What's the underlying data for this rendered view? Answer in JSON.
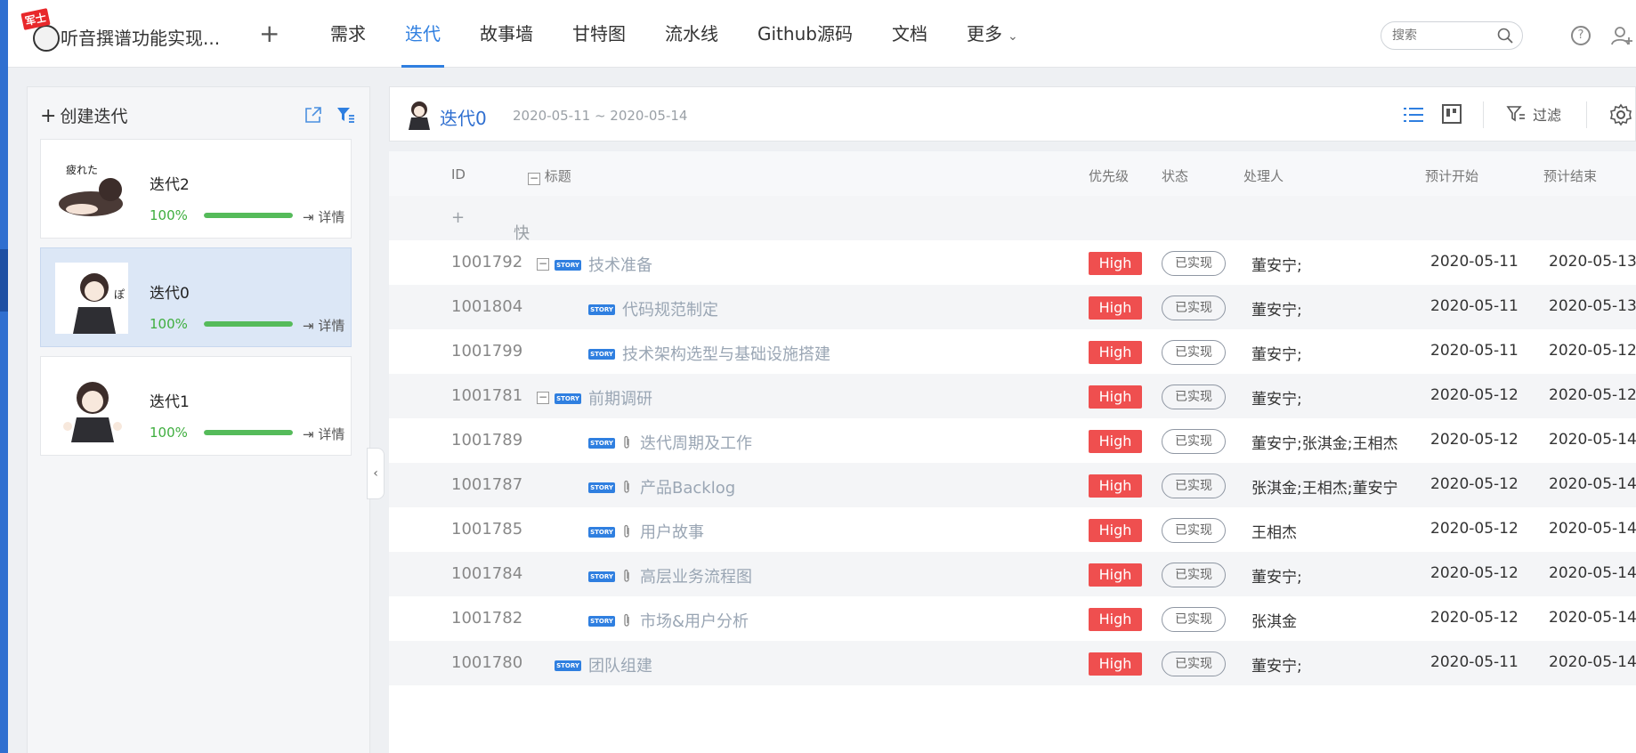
{
  "project": {
    "name": "听音撰谱功能实现...",
    "badge": "军士"
  },
  "nav": {
    "tabs": [
      {
        "label": "需求"
      },
      {
        "label": "迭代"
      },
      {
        "label": "故事墙"
      },
      {
        "label": "甘特图"
      },
      {
        "label": "流水线"
      },
      {
        "label": "Github源码"
      },
      {
        "label": "文档"
      },
      {
        "label": "更多"
      }
    ],
    "active_index": 1,
    "search_placeholder": "搜索"
  },
  "sidebar": {
    "create_label": "创建迭代",
    "iterations": [
      {
        "name": "迭代2",
        "percent": "100%",
        "progress": 1.0,
        "detail_label": "详情",
        "thumb_text": "疲れた"
      },
      {
        "name": "迭代0",
        "percent": "100%",
        "progress": 1.0,
        "detail_label": "详情",
        "thumb_text": "ぽ"
      },
      {
        "name": "迭代1",
        "percent": "100%",
        "progress": 1.0,
        "detail_label": "详情",
        "thumb_text": ""
      }
    ]
  },
  "iteration_header": {
    "title": "迭代0",
    "date_range": "2020-05-11 ~ 2020-05-14",
    "filter_label": "过滤"
  },
  "table": {
    "columns": {
      "id": "ID",
      "title": "标题",
      "priority": "优先级",
      "status": "状态",
      "owner": "处理人",
      "start": "预计开始",
      "end": "预计结束"
    },
    "quick_create_label": "快速创建",
    "story_tag": "STORY",
    "rows": [
      {
        "id": "1001792",
        "title": "技术准备",
        "level": 0,
        "foldable": true,
        "attachment": false,
        "priority": "High",
        "status": "已实现",
        "owner": "董安宁;",
        "start": "2020-05-11",
        "end": "2020-05-13"
      },
      {
        "id": "1001804",
        "title": "代码规范制定",
        "level": 1,
        "foldable": false,
        "attachment": false,
        "priority": "High",
        "status": "已实现",
        "owner": "董安宁;",
        "start": "2020-05-11",
        "end": "2020-05-13"
      },
      {
        "id": "1001799",
        "title": "技术架构选型与基础设施搭建",
        "level": 1,
        "foldable": false,
        "attachment": false,
        "priority": "High",
        "status": "已实现",
        "owner": "董安宁;",
        "start": "2020-05-11",
        "end": "2020-05-12"
      },
      {
        "id": "1001781",
        "title": "前期调研",
        "level": 0,
        "foldable": true,
        "attachment": false,
        "priority": "High",
        "status": "已实现",
        "owner": "董安宁;",
        "start": "2020-05-12",
        "end": "2020-05-12"
      },
      {
        "id": "1001789",
        "title": "迭代周期及工作",
        "level": 1,
        "foldable": false,
        "attachment": true,
        "priority": "High",
        "status": "已实现",
        "owner": "董安宁;张淇金;王相杰",
        "start": "2020-05-12",
        "end": "2020-05-14"
      },
      {
        "id": "1001787",
        "title": "产品Backlog",
        "level": 1,
        "foldable": false,
        "attachment": true,
        "priority": "High",
        "status": "已实现",
        "owner": "张淇金;王相杰;董安宁",
        "start": "2020-05-12",
        "end": "2020-05-14"
      },
      {
        "id": "1001785",
        "title": "用户故事",
        "level": 1,
        "foldable": false,
        "attachment": true,
        "priority": "High",
        "status": "已实现",
        "owner": "王相杰",
        "start": "2020-05-12",
        "end": "2020-05-14"
      },
      {
        "id": "1001784",
        "title": "高层业务流程图",
        "level": 1,
        "foldable": false,
        "attachment": true,
        "priority": "High",
        "status": "已实现",
        "owner": "董安宁;",
        "start": "2020-05-12",
        "end": "2020-05-14"
      },
      {
        "id": "1001782",
        "title": "市场&用户分析",
        "level": 1,
        "foldable": false,
        "attachment": true,
        "priority": "High",
        "status": "已实现",
        "owner": "张淇金",
        "start": "2020-05-12",
        "end": "2020-05-14"
      },
      {
        "id": "1001780",
        "title": "团队组建",
        "level": 0,
        "foldable": false,
        "attachment": false,
        "priority": "High",
        "status": "已实现",
        "owner": "董安宁;",
        "start": "2020-05-11",
        "end": "2020-05-14"
      }
    ]
  },
  "colors": {
    "accent": "#2f7fe0",
    "priority_high": "#ef4f4f",
    "progress": "#55bb5a"
  }
}
